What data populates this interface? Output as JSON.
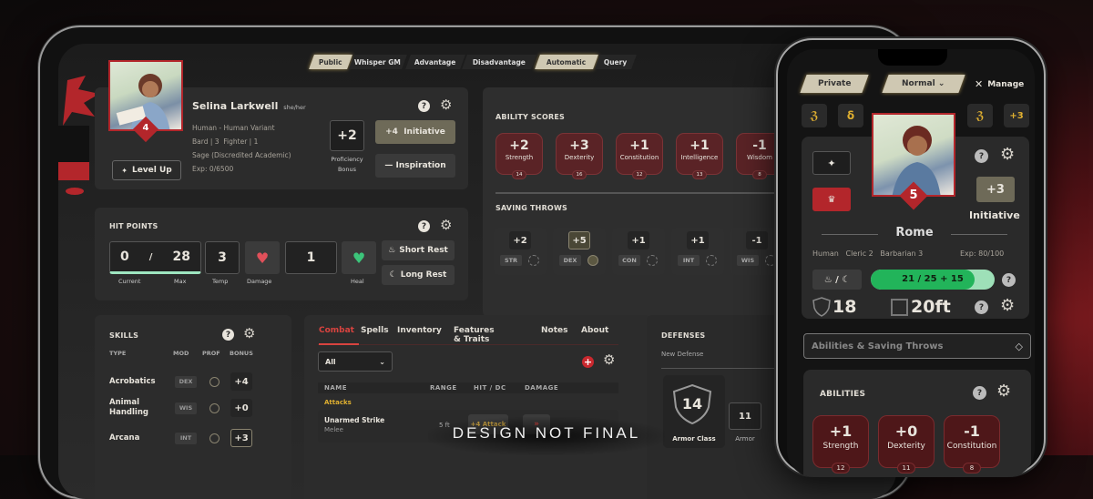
{
  "tablet": {
    "roll_modes": [
      {
        "label": "Public",
        "active": true
      },
      {
        "label": "Whisper GM",
        "active": false
      },
      {
        "label": "Advantage",
        "active": false
      },
      {
        "label": "Disadvantage",
        "active": false
      },
      {
        "label": "Automatic",
        "active": true
      },
      {
        "label": "Query",
        "active": false
      }
    ],
    "character": {
      "name": "Selina Larkwell",
      "pronouns": "she/her",
      "level": "4",
      "race": "Human - Human Variant",
      "classes": "Bard | 3  Fighter | 1",
      "background": "Sage (Discredited Academic)",
      "exp": "Exp: 0/6500",
      "level_up_label": "Level Up",
      "proficiency_bonus": "+2",
      "proficiency_label": "Proficiency Bonus",
      "initiative_label": "+4  Initiative",
      "inspiration_label": "— Inspiration"
    },
    "hit_points": {
      "title": "HIT POINTS",
      "current": "0",
      "separator": "/",
      "max": "28",
      "temp": "3",
      "amount": "1",
      "current_label": "Current",
      "max_label": "Max",
      "temp_label": "Temp",
      "damage_label": "Damage",
      "heal_label": "Heal",
      "short_rest": "Short Rest",
      "long_rest": "Long Rest"
    },
    "ability_scores": {
      "title": "ABILITY SCORES",
      "items": [
        {
          "mod": "+2",
          "name": "Strength",
          "score": "14"
        },
        {
          "mod": "+3",
          "name": "Dexterity",
          "score": "16"
        },
        {
          "mod": "+1",
          "name": "Constitution",
          "score": "12"
        },
        {
          "mod": "+1",
          "name": "Intelligence",
          "score": "13"
        },
        {
          "mod": "-1",
          "name": "Wisdom",
          "score": "8"
        }
      ]
    },
    "saving_throws": {
      "title": "SAVING THROWS",
      "items": [
        {
          "value": "+2",
          "abbr": "STR",
          "proficient": false
        },
        {
          "value": "+5",
          "abbr": "DEX",
          "proficient": true
        },
        {
          "value": "+1",
          "abbr": "CON",
          "proficient": false
        },
        {
          "value": "+1",
          "abbr": "INT",
          "proficient": false
        },
        {
          "value": "-1",
          "abbr": "WIS",
          "proficient": false
        }
      ]
    },
    "skills": {
      "title": "SKILLS",
      "headers": {
        "type": "TYPE",
        "mod": "MOD",
        "prof": "PROF",
        "bonus": "BONUS"
      },
      "rows": [
        {
          "name": "Acrobatics",
          "mod": "DEX",
          "bonus": "+4",
          "proficient": false
        },
        {
          "name": "Animal Handling",
          "mod": "WIS",
          "bonus": "+0",
          "proficient": false
        },
        {
          "name": "Arcana",
          "mod": "INT",
          "bonus": "+3",
          "proficient": true
        }
      ]
    },
    "combat": {
      "tabs": [
        "Combat",
        "Spells",
        "Inventory",
        "Features & Traits",
        "Notes",
        "About"
      ],
      "filter_value": "All",
      "headers": {
        "name": "NAME",
        "range": "RANGE",
        "hit": "HIT / DC",
        "damage": "DAMAGE"
      },
      "section": "Attacks",
      "attacks": [
        {
          "name": "Unarmed Strike",
          "type": "Melee",
          "range": "5 ft",
          "hit": "+4 Attack"
        }
      ]
    },
    "defenses": {
      "title": "DEFENSES",
      "new_label": "New Defense",
      "armor_class": "14",
      "armor_class_label": "Armor Class",
      "armor": "11",
      "armor_label": "Armor"
    }
  },
  "phone": {
    "privacy": "Private",
    "roll_mode": "Normal",
    "manage_label": "Manage",
    "badge_right": "+3",
    "level": "5",
    "initiative": "+3",
    "initiative_label": "Initiative",
    "name": "Rome",
    "race": "Human",
    "class1": "Cleric 2",
    "class2": "Barbarian 3",
    "exp": "Exp: 80/100",
    "hp_text": "21 / 25 + 15",
    "hp_fraction": 0.84,
    "armor_class": "18",
    "speed": "20ft",
    "section_select": "Abilities & Saving Throws",
    "abilities_title": "ABILITIES",
    "abilities": [
      {
        "mod": "+1",
        "name": "Strength",
        "score": "12"
      },
      {
        "mod": "+0",
        "name": "Dexterity",
        "score": "11"
      },
      {
        "mod": "-1",
        "name": "Constitution",
        "score": "8"
      }
    ]
  },
  "watermark": "DESIGN NOT FINAL",
  "colors": {
    "accent_red": "#b3262b",
    "hp_green": "#22b45a",
    "gold": "#e0b030",
    "tan": "#cfc8b2"
  }
}
